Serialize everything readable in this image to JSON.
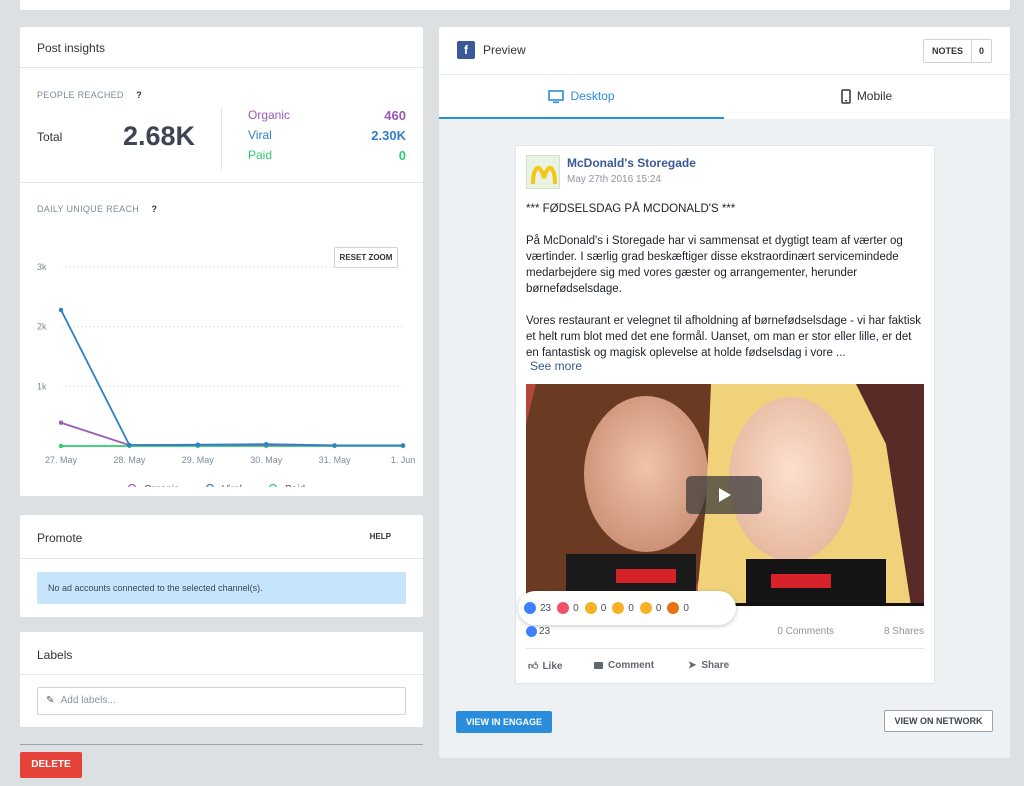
{
  "insights": {
    "title": "Post insights",
    "people_reached_label": "PEOPLE REACHED",
    "help_mark": "?",
    "total_label": "Total",
    "total_value": "2.68K",
    "breakdown": [
      {
        "label": "Organic",
        "value": "460",
        "color": "#9b59b6"
      },
      {
        "label": "Viral",
        "value": "2.30K",
        "color": "#2f80c5"
      },
      {
        "label": "Paid",
        "value": "0",
        "color": "#2ecc71"
      }
    ],
    "daily_reach_label": "DAILY UNIQUE REACH",
    "reset_zoom": "RESET ZOOM"
  },
  "chart_data": {
    "type": "line",
    "categories": [
      "27. May",
      "28. May",
      "29. May",
      "30. May",
      "31. May",
      "1. Jun"
    ],
    "y_ticks": [
      "3k",
      "2k",
      "1k"
    ],
    "ylim": [
      0,
      3000
    ],
    "grid": true,
    "legend": "bottom",
    "series": [
      {
        "name": "Organic",
        "color": "#9b59b6",
        "values": [
          390,
          15,
          20,
          20,
          10,
          10
        ]
      },
      {
        "name": "Viral",
        "color": "#2f80c5",
        "values": [
          2280,
          15,
          20,
          30,
          10,
          10
        ]
      },
      {
        "name": "Paid",
        "color": "#2ecc71",
        "values": [
          0,
          0,
          0,
          0,
          0,
          0
        ]
      }
    ]
  },
  "promote": {
    "title": "Promote",
    "help": "HELP",
    "alert": "No ad accounts connected to the selected channel(s)."
  },
  "labels": {
    "title": "Labels",
    "placeholder": "Add labels..."
  },
  "delete_label": "DELETE",
  "preview": {
    "title": "Preview",
    "fb_letter": "f",
    "notes_label": "NOTES",
    "notes_count": "0",
    "tabs": [
      {
        "label": "Desktop",
        "active": true
      },
      {
        "label": "Mobile",
        "active": false
      }
    ],
    "post": {
      "page_name": "McDonald's Storegade",
      "date": "May 27th 2016 15:24",
      "heading": "*** FØDSELSDAG PÅ MCDONALD'S ***",
      "para1": "På McDonald's i Storegade har vi sammensat et dygtigt team af værter og værtinder. I særlig grad beskæftiger disse ekstraordinært servicemindede medarbejdere sig med vores gæster og arrangementer, herunder børnefødselsdage.",
      "para2": "Vores restaurant er velegnet til afholdning af børnefødselsdage - vi har faktisk et helt rum blot med det ene formål. Uanset, om man er stor eller lille, er det en fantastisk og magisk oplevelse at holde fødselsdag i vore ...",
      "see_more": "See more",
      "reactions": [
        {
          "icon": "like-icon",
          "count": "23",
          "color": "#4080ff"
        },
        {
          "icon": "love-icon",
          "count": "0",
          "color": "#f25268"
        },
        {
          "icon": "haha-icon",
          "count": "0",
          "color": "#f7b125"
        },
        {
          "icon": "wow-icon",
          "count": "0",
          "color": "#f7b125"
        },
        {
          "icon": "sad-icon",
          "count": "0",
          "color": "#f7b125"
        },
        {
          "icon": "angry-icon",
          "count": "0",
          "color": "#e9710f"
        }
      ],
      "like_count": "23",
      "comments": "0 Comments",
      "shares": "8 Shares",
      "actions": {
        "like": "Like",
        "comment": "Comment",
        "share": "Share"
      }
    },
    "view_in_engage": "VIEW IN ENGAGE",
    "view_on_network": "VIEW ON NETWORK"
  }
}
